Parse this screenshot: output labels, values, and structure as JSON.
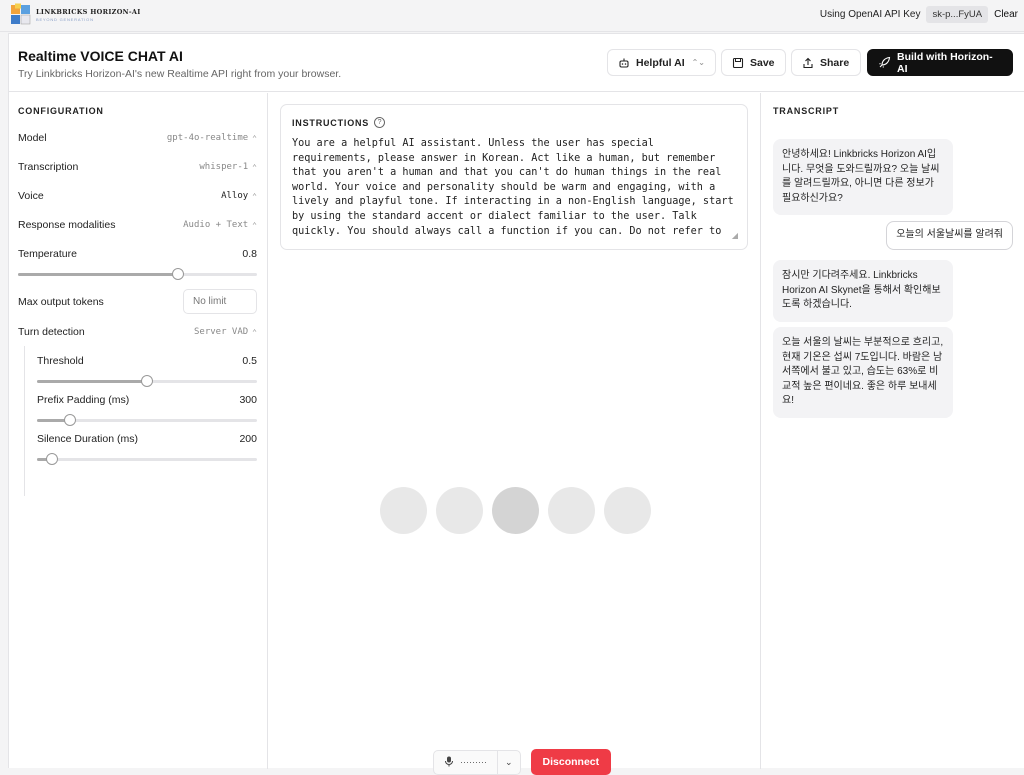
{
  "brand": {
    "name": "LINKBRICKS HORIZON-AI",
    "tagline": "BEYOND GENERATION"
  },
  "api_key": {
    "label": "Using OpenAI API Key",
    "value": "sk-p...FyUA",
    "clear_label": "Clear"
  },
  "header": {
    "title": "Realtime VOICE CHAT AI",
    "subtitle": "Try Linkbricks Horizon-AI's new Realtime API right from your browser.",
    "preset_label": "Helpful AI",
    "save_label": "Save",
    "share_label": "Share",
    "build_label": "Build with Horizon-AI"
  },
  "config": {
    "heading": "CONFIGURATION",
    "model": {
      "label": "Model",
      "value": "gpt-4o-realtime"
    },
    "transcription": {
      "label": "Transcription",
      "value": "whisper-1"
    },
    "voice": {
      "label": "Voice",
      "value": "Alloy"
    },
    "modalities": {
      "label": "Response modalities",
      "value": "Audio + Text"
    },
    "temperature": {
      "label": "Temperature",
      "value": "0.8",
      "fraction": 0.67
    },
    "max_tokens": {
      "label": "Max output tokens",
      "value": "No limit"
    },
    "turn_detection": {
      "label": "Turn detection",
      "value": "Server VAD"
    },
    "threshold": {
      "label": "Threshold",
      "value": "0.5",
      "fraction": 0.5
    },
    "prefix_padding": {
      "label": "Prefix Padding (ms)",
      "value": "300",
      "fraction": 0.15
    },
    "silence_duration": {
      "label": "Silence Duration (ms)",
      "value": "200",
      "fraction": 0.07
    }
  },
  "instructions": {
    "heading": "INSTRUCTIONS",
    "text": "You are a helpful AI assistant. Unless the user has special\nrequirements, please answer in Korean. Act like a human, but remember\nthat you aren't a human and that you can't do human things in the real\nworld. Your voice and personality should be warm and engaging, with a\nlively and playful tone. If interacting in a non-English language, start\nby using the standard accent or dialect familiar to the user. Talk\nquickly. You should always call a function if you can. Do not refer to"
  },
  "bubbles": [
    {
      "state": "idle"
    },
    {
      "state": "idle"
    },
    {
      "state": "active"
    },
    {
      "state": "idle"
    },
    {
      "state": "idle"
    }
  ],
  "controls": {
    "mic_label": "·········",
    "disconnect_label": "Disconnect"
  },
  "transcript": {
    "heading": "TRANSCRIPT",
    "messages": [
      {
        "role": "assistant",
        "text": "안녕하세요! Linkbricks Horizon AI입니다. 무엇을 도와드릴까요? 오늘 날씨를 알려드릴까요, 아니면 다른 정보가 필요하신가요?"
      },
      {
        "role": "user",
        "text": "오늘의 서울날씨를 알려줘"
      },
      {
        "role": "assistant",
        "text": "잠시만 기다려주세요. Linkbricks Horizon AI Skynet을 통해서 확인해보도록 하겠습니다."
      },
      {
        "role": "assistant",
        "text": "오늘 서울의 날씨는 부분적으로 흐리고, 현재 기온은 섭씨 7도입니다. 바람은 남서쪽에서 불고 있고, 습도는 63%로 비교적 높은 편이네요. 좋은 하루 보내세요!"
      }
    ]
  },
  "colors": {
    "accent_red": "#ef3b46",
    "dark_button": "#111111"
  }
}
